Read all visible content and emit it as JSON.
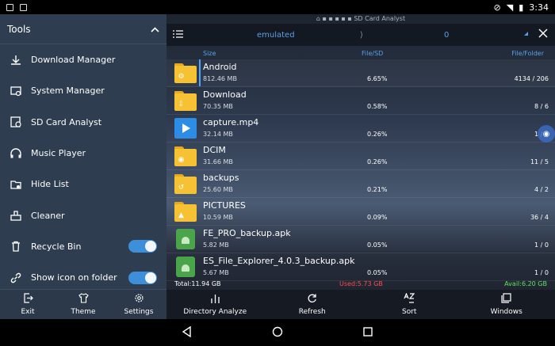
{
  "status": {
    "time": "3:34"
  },
  "drawer": {
    "title": "Tools",
    "items": [
      {
        "label": "Download Manager",
        "icon": "download-icon"
      },
      {
        "label": "System Manager",
        "icon": "system-manager-icon"
      },
      {
        "label": "SD Card Analyst",
        "icon": "sd-card-analyst-icon"
      },
      {
        "label": "Music Player",
        "icon": "headphones-icon"
      },
      {
        "label": "Hide List",
        "icon": "hide-list-icon"
      },
      {
        "label": "Cleaner",
        "icon": "cleaner-icon"
      },
      {
        "label": "Recycle Bin",
        "icon": "trash-icon",
        "toggle": true
      },
      {
        "label": "Show icon on folder",
        "icon": "link-icon",
        "toggle": true
      }
    ],
    "footer": [
      {
        "label": "Exit",
        "icon": "exit-icon"
      },
      {
        "label": "Theme",
        "icon": "shirt-icon"
      },
      {
        "label": "Settings",
        "icon": "gear-icon"
      }
    ]
  },
  "main": {
    "app_title": "SD Card Analyst",
    "path": "emulated",
    "separator": "⟩",
    "selected_count": "0",
    "columns": {
      "size": "Size",
      "filesd": "File/SD",
      "filefolder": "File/Folder"
    },
    "rows": [
      {
        "name": "Android",
        "size": "812.46 MB",
        "pct": "6.65%",
        "count": "4134 / 206",
        "type": "folder",
        "glyph": "⚙"
      },
      {
        "name": "Download",
        "size": "70.35 MB",
        "pct": "0.58%",
        "count": "8 / 6",
        "type": "folder",
        "glyph": "⇩"
      },
      {
        "name": "capture.mp4",
        "size": "32.14 MB",
        "pct": "0.26%",
        "count": "1 / 0",
        "type": "video"
      },
      {
        "name": "DCIM",
        "size": "31.66 MB",
        "pct": "0.26%",
        "count": "11 / 5",
        "type": "folder",
        "glyph": "◉"
      },
      {
        "name": "backups",
        "size": "25.60 MB",
        "pct": "0.21%",
        "count": "4 / 2",
        "type": "folder",
        "glyph": "↺"
      },
      {
        "name": "PICTURES",
        "size": "10.59 MB",
        "pct": "0.09%",
        "count": "36 / 4",
        "type": "folder",
        "glyph": "▲"
      },
      {
        "name": "FE_PRO_backup.apk",
        "size": "5.82 MB",
        "pct": "0.05%",
        "count": "1 / 0",
        "type": "apk"
      },
      {
        "name": "ES_File_Explorer_4.0.3_backup.apk",
        "size": "5.67 MB",
        "pct": "0.05%",
        "count": "1 / 0",
        "type": "apk"
      }
    ],
    "usage": {
      "total": "Total:11.94 GB",
      "used": "Used:5.73 GB",
      "avail": "Avail:6.20 GB"
    },
    "bottom": [
      {
        "label": "Directory Analyze",
        "icon": "bars-icon"
      },
      {
        "label": "Refresh",
        "icon": "refresh-icon"
      },
      {
        "label": "Sort",
        "icon": "sort-az-icon"
      },
      {
        "label": "Windows",
        "icon": "windows-icon"
      }
    ]
  },
  "colors": {
    "accent": "#3d8fd9",
    "used": "#ff4b4b",
    "avail": "#5fe35f",
    "folder": "#f6c233"
  }
}
